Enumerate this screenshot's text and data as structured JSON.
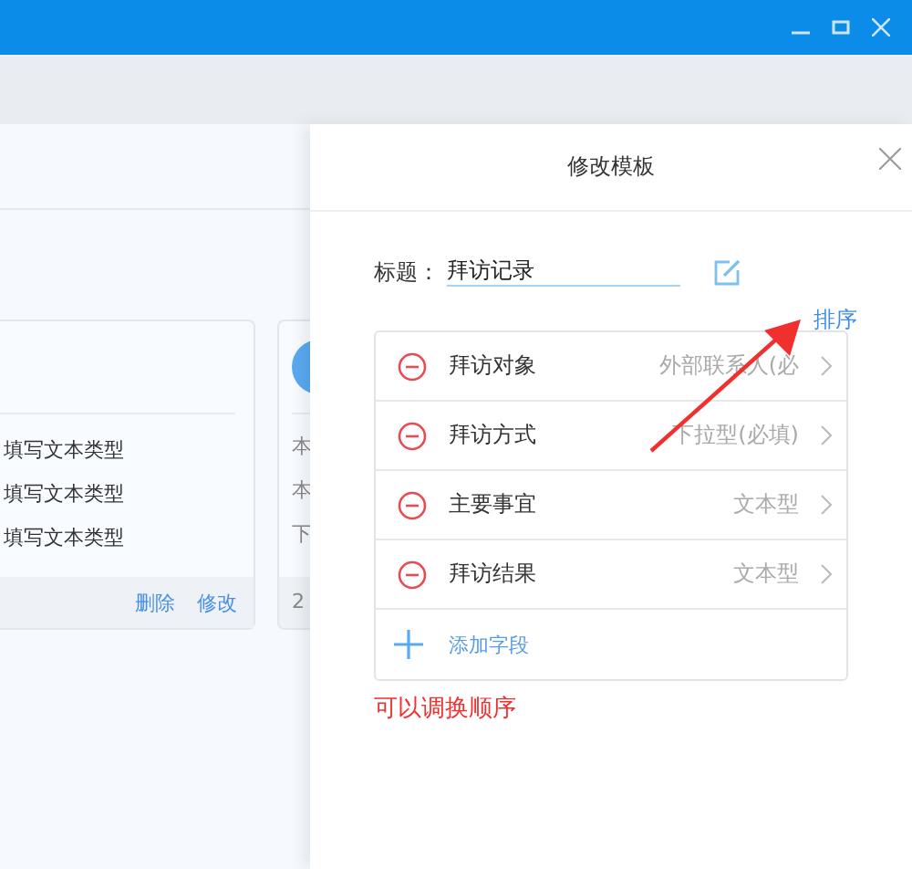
{
  "cards": [
    {
      "field_types": [
        "填写文本类型",
        "填写文本类型",
        "填写文本类型"
      ],
      "actions": [
        "删除",
        "修改"
      ]
    },
    {
      "lines": [
        "本",
        "本",
        "下"
      ],
      "footer": "2"
    }
  ],
  "panel": {
    "title": "修改模板",
    "title_label": "标题：",
    "title_value": "拜访记录",
    "sort_link": "排序",
    "fields": [
      {
        "name": "拜访对象",
        "type": "外部联系人(必"
      },
      {
        "name": "拜访方式",
        "type": "下拉型(必填)"
      },
      {
        "name": "主要事宜",
        "type": "文本型"
      },
      {
        "name": "拜访结果",
        "type": "文本型"
      }
    ],
    "add_field": "添加字段"
  },
  "annotation": {
    "text": "可以调换顺序"
  }
}
